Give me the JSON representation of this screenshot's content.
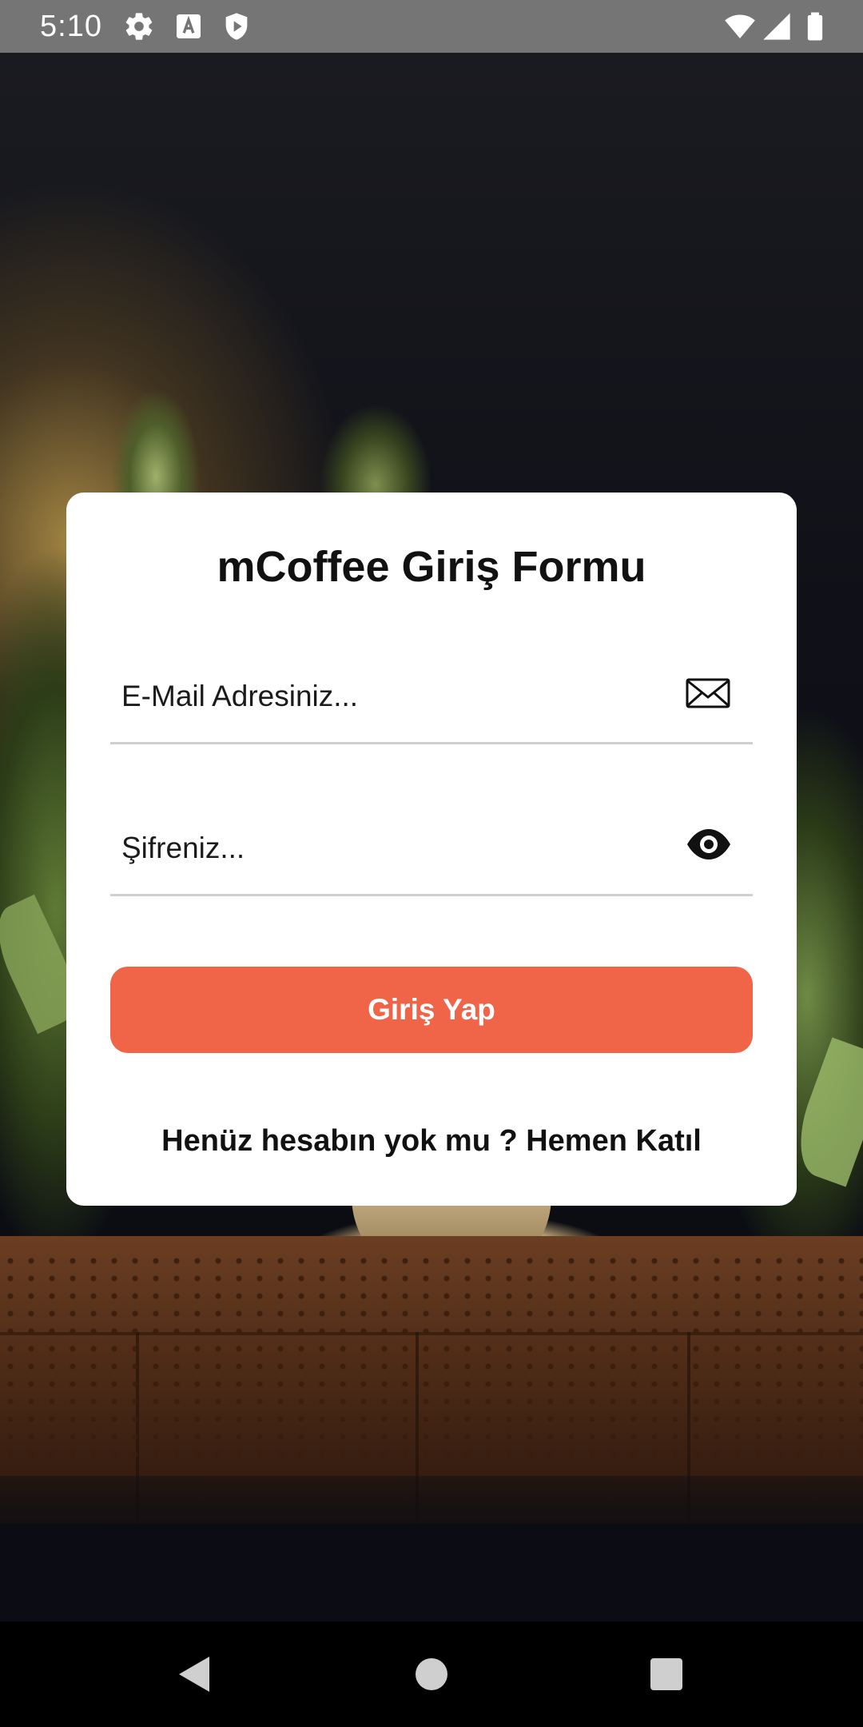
{
  "status_bar": {
    "time": "5:10",
    "left_icons": [
      "settings-icon",
      "a-keyboard-icon",
      "shield-play-icon"
    ],
    "right_icons": [
      "wifi-icon",
      "signal-icon",
      "battery-icon"
    ]
  },
  "form": {
    "title": "mCoffee Giriş Formu",
    "email": {
      "placeholder": "E-Mail Adresiniz...",
      "icon": "mail-icon"
    },
    "password": {
      "placeholder": "Şifreniz...",
      "icon": "eye-icon"
    },
    "submit_label": "Giriş Yap",
    "signup_text": "Henüz hesabın yok mu ? Hemen Katıl"
  },
  "nav_bar": {
    "icons": [
      "back-icon",
      "home-icon",
      "recent-apps-icon"
    ]
  },
  "colors": {
    "accent": "#f06548",
    "card": "#ffffff",
    "status_bar": "#757575",
    "nav_bar": "#000000"
  }
}
